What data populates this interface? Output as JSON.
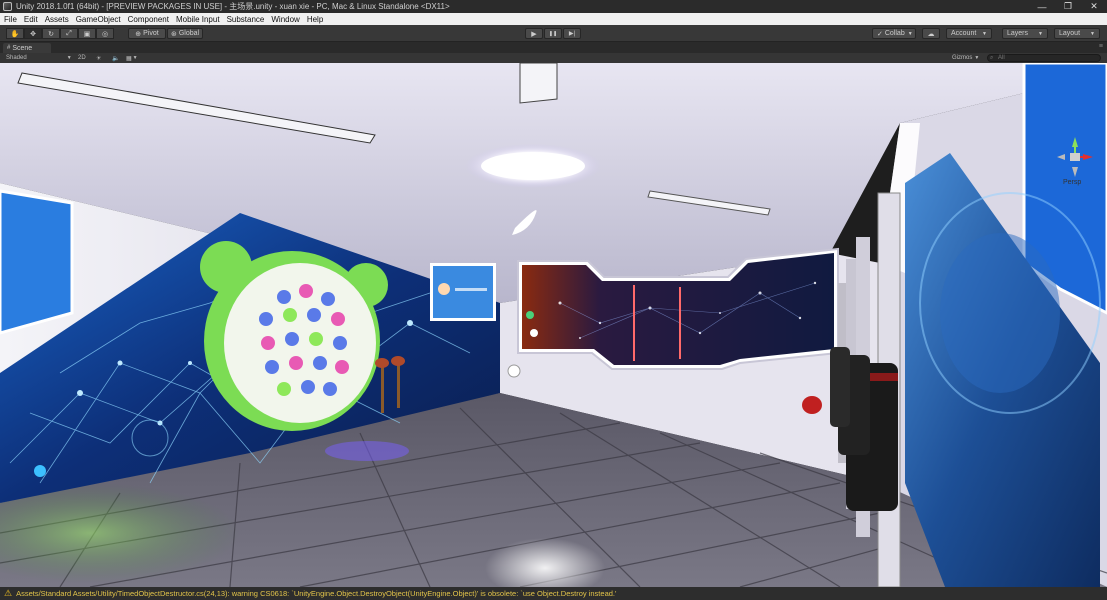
{
  "window": {
    "title": "Unity 2018.1.0f1 (64bit) - [PREVIEW PACKAGES IN USE] - 主场景.unity - xuan xie - PC, Mac & Linux Standalone <DX11>",
    "minimize": "—",
    "restore": "❐",
    "close": "✕"
  },
  "menu": [
    "File",
    "Edit",
    "Assets",
    "GameObject",
    "Component",
    "Mobile Input",
    "Substance",
    "Window",
    "Help"
  ],
  "toolbar": {
    "pivot_label": "Pivot",
    "global_label": "Global",
    "play_icon": "▶",
    "pause_icon": "❚❚",
    "step_icon": "▶|",
    "collab_label": "Collab",
    "account_label": "Account",
    "layers_label": "Layers",
    "layout_label": "Layout"
  },
  "scene_tab": {
    "label": "Scene"
  },
  "scene_bar": {
    "shading_mode": "Shaded",
    "mode_2d": "2D",
    "gizmos_label": "Gizmos",
    "search_placeholder": "All"
  },
  "gizmo": {
    "projection": "Persp"
  },
  "status": {
    "message": "Assets/Standard Assets/Utility/TimedObjectDestructor.cs(24,13): warning CS0618: `UnityEngine.Object.DestroyObject(UnityEngine.Object)' is obsolete: `use Object.Destroy instead.'"
  },
  "colors": {
    "editor_dark": "#383838",
    "menu_bg": "#f0f0f0",
    "warning": "#e2c44a",
    "wall_blue": "#1a5fb4",
    "accent_green": "#7cdc54"
  }
}
